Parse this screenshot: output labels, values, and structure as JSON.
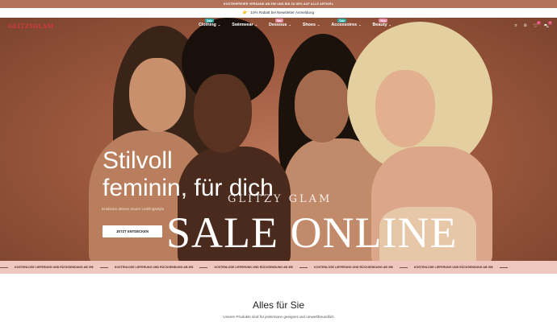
{
  "topbar": {
    "text": "KOSTENFREIER VERSAND AB 39€ UND BIS ZU 80% AUF ALLE ARTIKEL"
  },
  "promo": {
    "icon": "hand-icon",
    "text": "10% Rabatt bei Newsletter Anmeldung"
  },
  "header": {
    "logo": "GLITZYGLAM",
    "menu": [
      {
        "label": "Clothing",
        "badge": "Sale",
        "badge_color": "#2aa7a0"
      },
      {
        "label": "Swimwear",
        "badge": "",
        "badge_color": ""
      },
      {
        "label": "Dessous",
        "badge": "Neu",
        "badge_color": "#e48aa2"
      },
      {
        "label": "Shoes",
        "badge": "",
        "badge_color": ""
      },
      {
        "label": "Accessoires",
        "badge": "Sale",
        "badge_color": "#2aa7a0"
      },
      {
        "label": "Beauty",
        "badge": "Neu",
        "badge_color": "#e48aa2"
      }
    ],
    "icons": [
      "search-icon",
      "user-icon",
      "heart-icon",
      "cart-icon"
    ],
    "wishlist_count": "0",
    "cart_count": "0"
  },
  "hero": {
    "headline_line1": "Stilvoll",
    "headline_line2": "feminin, für dich",
    "subtext": "Entdecke deinen neuen Lieblingsstyle",
    "cta": "JETZT ENTDECKEN",
    "brand_watermark": "GLITZY GLAM",
    "sale_text": "SALE ONLINE"
  },
  "ticker": {
    "items": [
      "KOSTENLOSE LIEFERUNG UND RÜCKSENDUNG AB 39€",
      "KOSTENLOSE LIEFERUNG UND RÜCKSENDUNG AB 39€",
      "KOSTENLOSE LIEFERUNG UND RÜCKSENDUNG AB 39€",
      "KOSTENLOSE LIEFERUNG UND RÜCKSENDUNG AB 39€",
      "KOSTENLOSE LIEFERUNG UND RÜCKSENDUNG AB 39€"
    ]
  },
  "section": {
    "title": "Alles für Sie",
    "subtitle": "Unsere Produkte sind für jedermann geeignet und umweltfreundlich"
  },
  "colors": {
    "accent": "#b3735a",
    "ticker_bg": "#f0c7bf",
    "logo": "#d43a3a"
  }
}
